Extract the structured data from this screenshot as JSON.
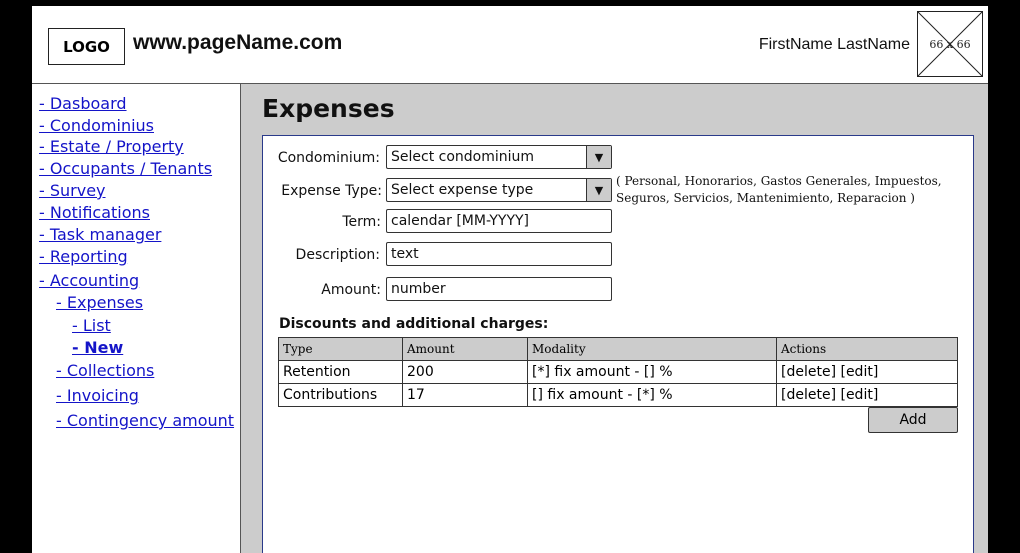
{
  "header": {
    "logo": "LOGO",
    "site": "www.pageName.com",
    "user_name": "FirstName LastName",
    "avatar_label": "66 x 66"
  },
  "sidebar": {
    "items": [
      {
        "label": "- Dasboard"
      },
      {
        "label": "- Condominius"
      },
      {
        "label": "- Estate / Property"
      },
      {
        "label": "- Occupants / Tenants"
      },
      {
        "label": "- Survey"
      },
      {
        "label": "- Notifications"
      },
      {
        "label": "- Task manager"
      },
      {
        "label": "- Reporting"
      },
      {
        "label": "- Accounting"
      },
      {
        "label": "- Expenses"
      },
      {
        "label": "- List"
      },
      {
        "label": "- New"
      },
      {
        "label": "- Collections"
      },
      {
        "label": "- Invoicing"
      },
      {
        "label": "- Contingency amount"
      }
    ]
  },
  "main": {
    "title": "Expenses",
    "form": {
      "condominium_label": "Condominium:",
      "condominium_value": "Select condominium",
      "expense_type_label": "Expense Type:",
      "expense_type_value": "Select expense type",
      "expense_type_hint": "( Personal, Honorarios, Gastos Generales, Impuestos, Seguros, Servicios, Mantenimiento, Reparacion )",
      "term_label": "Term:",
      "term_value": "calendar [MM-YYYY]",
      "description_label": "Description:",
      "description_value": "text",
      "amount_label": "Amount:",
      "amount_value": "number"
    },
    "discounts": {
      "title": "Discounts and additional charges:",
      "columns": [
        "Type",
        "Amount",
        "Modality",
        "Actions"
      ],
      "rows": [
        {
          "type": "Retention",
          "amount": "200",
          "modality": "[*] fix amount - [] %",
          "actions": "[delete] [edit]"
        },
        {
          "type": "Contributions",
          "amount": "17",
          "modality": "[] fix amount - [*] %",
          "actions": "[delete] [edit]"
        }
      ],
      "add_label": "Add"
    }
  },
  "icons": {
    "dropdown": "chevron-down-icon",
    "avatar": "image-placeholder-icon"
  }
}
